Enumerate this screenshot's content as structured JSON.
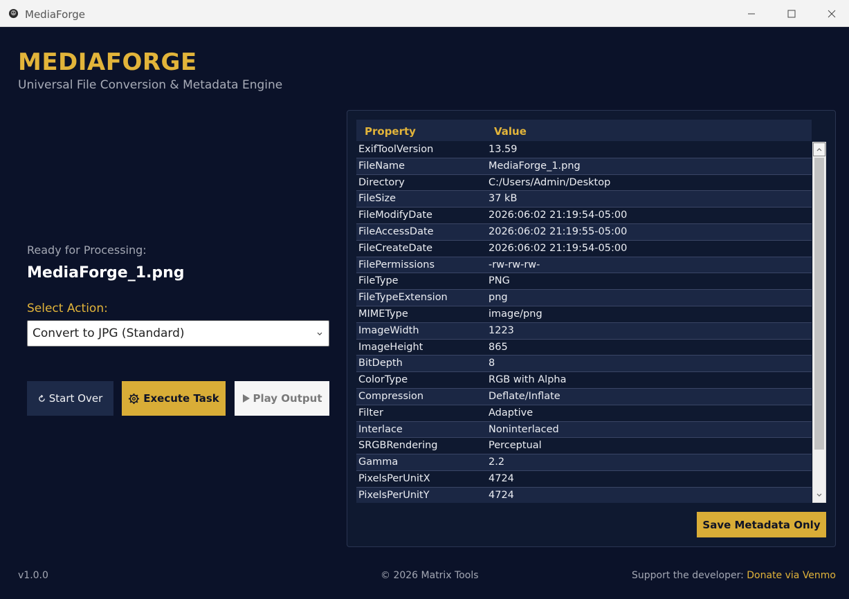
{
  "window": {
    "title": "MediaForge"
  },
  "header": {
    "brand": "MEDIAFORGE",
    "subtitle": "Universal File Conversion & Metadata Engine"
  },
  "left_panel": {
    "ready_label": "Ready for Processing:",
    "file_name": "MediaForge_1.png",
    "select_label": "Select Action:",
    "selected_action": "Convert to JPG (Standard)",
    "buttons": {
      "start_over": "Start Over",
      "execute": "Execute Task",
      "play_output": "Play Output"
    }
  },
  "metadata": {
    "columns": [
      "Property",
      "Value"
    ],
    "rows": [
      {
        "property": "ExifToolVersion",
        "value": "13.59"
      },
      {
        "property": "FileName",
        "value": "MediaForge_1.png"
      },
      {
        "property": "Directory",
        "value": "C:/Users/Admin/Desktop"
      },
      {
        "property": "FileSize",
        "value": "37 kB"
      },
      {
        "property": "FileModifyDate",
        "value": "2026:06:02 21:19:54-05:00"
      },
      {
        "property": "FileAccessDate",
        "value": "2026:06:02 21:19:55-05:00"
      },
      {
        "property": "FileCreateDate",
        "value": "2026:06:02 21:19:54-05:00"
      },
      {
        "property": "FilePermissions",
        "value": "-rw-rw-rw-"
      },
      {
        "property": "FileType",
        "value": "PNG"
      },
      {
        "property": "FileTypeExtension",
        "value": "png"
      },
      {
        "property": "MIMEType",
        "value": "image/png"
      },
      {
        "property": "ImageWidth",
        "value": "1223"
      },
      {
        "property": "ImageHeight",
        "value": "865"
      },
      {
        "property": "BitDepth",
        "value": "8"
      },
      {
        "property": "ColorType",
        "value": "RGB with Alpha"
      },
      {
        "property": "Compression",
        "value": "Deflate/Inflate"
      },
      {
        "property": "Filter",
        "value": "Adaptive"
      },
      {
        "property": "Interlace",
        "value": "Noninterlaced"
      },
      {
        "property": "SRGBRendering",
        "value": "Perceptual"
      },
      {
        "property": "Gamma",
        "value": "2.2"
      },
      {
        "property": "PixelsPerUnitX",
        "value": "4724"
      },
      {
        "property": "PixelsPerUnitY",
        "value": "4724"
      }
    ],
    "save_button": "Save Metadata Only"
  },
  "footer": {
    "version": "v1.0.0",
    "copyright": "© 2026 Matrix Tools",
    "support_text": "Support the developer: ",
    "donate_link": "Donate via Venmo"
  },
  "colors": {
    "background": "#0b1229",
    "accent": "#e2b43a",
    "panel": "#0f1930",
    "row_alt": "#1b2744"
  }
}
